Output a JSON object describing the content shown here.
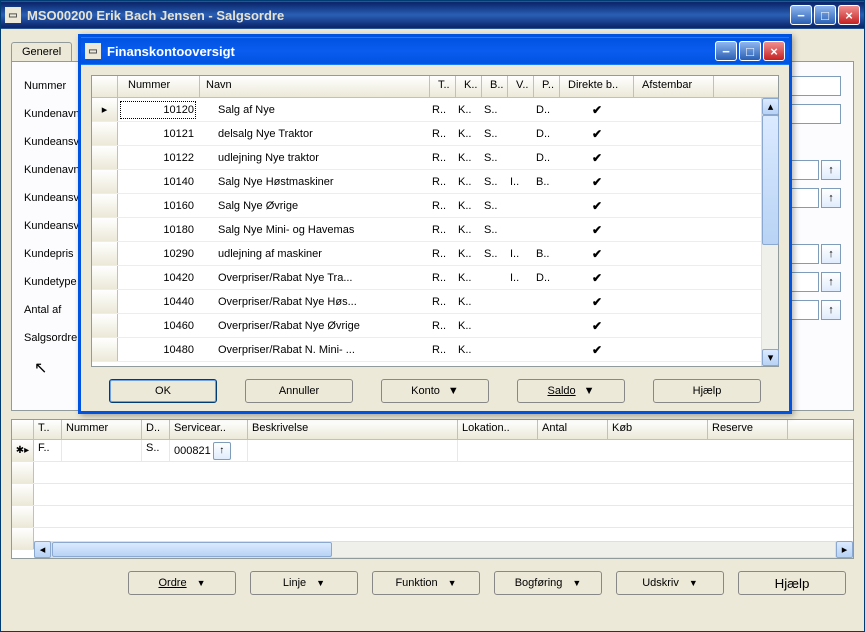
{
  "mainWindow": {
    "title": "MSO00200 Erik Bach Jensen - Salgsordre",
    "tabs": [
      "Generel"
    ],
    "formLabels": [
      "Nummer",
      "Kundenavn",
      "Kundeansvarlig",
      "Kundenavn",
      "Kundeansvar",
      "Kundeansvar",
      "Kundepris",
      "Kundetype",
      "Antal af",
      "Salgsordrer"
    ]
  },
  "grid": {
    "headers": [
      "T..",
      "Nummer",
      "D..",
      "Servicear..",
      "Beskrivelse",
      "Lokation..",
      "Antal",
      "Køb",
      "Reserve"
    ],
    "row": {
      "t": "F..",
      "d": "S..",
      "servicear": "000821"
    }
  },
  "bottomButtons": {
    "ordre": "Ordre",
    "linje": "Linje",
    "funktion": "Funktion",
    "bogforing": "Bogføring",
    "udskriv": "Udskriv",
    "hjaelp": "Hjælp"
  },
  "dialog": {
    "title": "Finanskontooversigt",
    "headers": {
      "nummer": "Nummer",
      "navn": "Navn",
      "t": "T..",
      "k": "K..",
      "b": "B..",
      "v": "V..",
      "p": "P..",
      "db": "Direkte b..",
      "af": "Afstembar"
    },
    "rows": [
      {
        "active": true,
        "nummer": "10120",
        "navn": "Salg af Nye",
        "t": "R..",
        "k": "K..",
        "b": "S..",
        "v": "",
        "p": "D..",
        "db": true
      },
      {
        "nummer": "10121",
        "navn": "delsalg Nye Traktor",
        "t": "R..",
        "k": "K..",
        "b": "S..",
        "v": "",
        "p": "D..",
        "db": true
      },
      {
        "nummer": "10122",
        "navn": "udlejning Nye traktor",
        "t": "R..",
        "k": "K..",
        "b": "S..",
        "v": "",
        "p": "D..",
        "db": true
      },
      {
        "nummer": "10140",
        "navn": "Salg Nye Høstmaskiner",
        "t": "R..",
        "k": "K..",
        "b": "S..",
        "v": "I..",
        "p": "B..",
        "db": true
      },
      {
        "nummer": "10160",
        "navn": "Salg Nye Øvrige",
        "t": "R..",
        "k": "K..",
        "b": "S..",
        "v": "",
        "p": "",
        "db": true
      },
      {
        "nummer": "10180",
        "navn": "Salg Nye Mini- og Havemas",
        "t": "R..",
        "k": "K..",
        "b": "S..",
        "v": "",
        "p": "",
        "db": true
      },
      {
        "nummer": "10290",
        "navn": "udlejning af maskiner",
        "t": "R..",
        "k": "K..",
        "b": "S..",
        "v": "I..",
        "p": "B..",
        "db": true
      },
      {
        "nummer": "10420",
        "navn": "Overpriser/Rabat Nye Tra...",
        "t": "R..",
        "k": "K..",
        "b": "",
        "v": "I..",
        "p": "D..",
        "db": true
      },
      {
        "nummer": "10440",
        "navn": "Overpriser/Rabat Nye Høs...",
        "t": "R..",
        "k": "K..",
        "b": "",
        "v": "",
        "p": "",
        "db": true
      },
      {
        "nummer": "10460",
        "navn": "Overpriser/Rabat Nye Øvrige",
        "t": "R..",
        "k": "K..",
        "b": "",
        "v": "",
        "p": "",
        "db": true
      },
      {
        "nummer": "10480",
        "navn": "Overpriser/Rabat N. Mini- ...",
        "t": "R..",
        "k": "K..",
        "b": "",
        "v": "",
        "p": "",
        "db": true
      }
    ],
    "buttons": {
      "ok": "OK",
      "annuller": "Annuller",
      "konto": "Konto",
      "saldo": "Saldo",
      "hjaelp": "Hjælp"
    }
  }
}
